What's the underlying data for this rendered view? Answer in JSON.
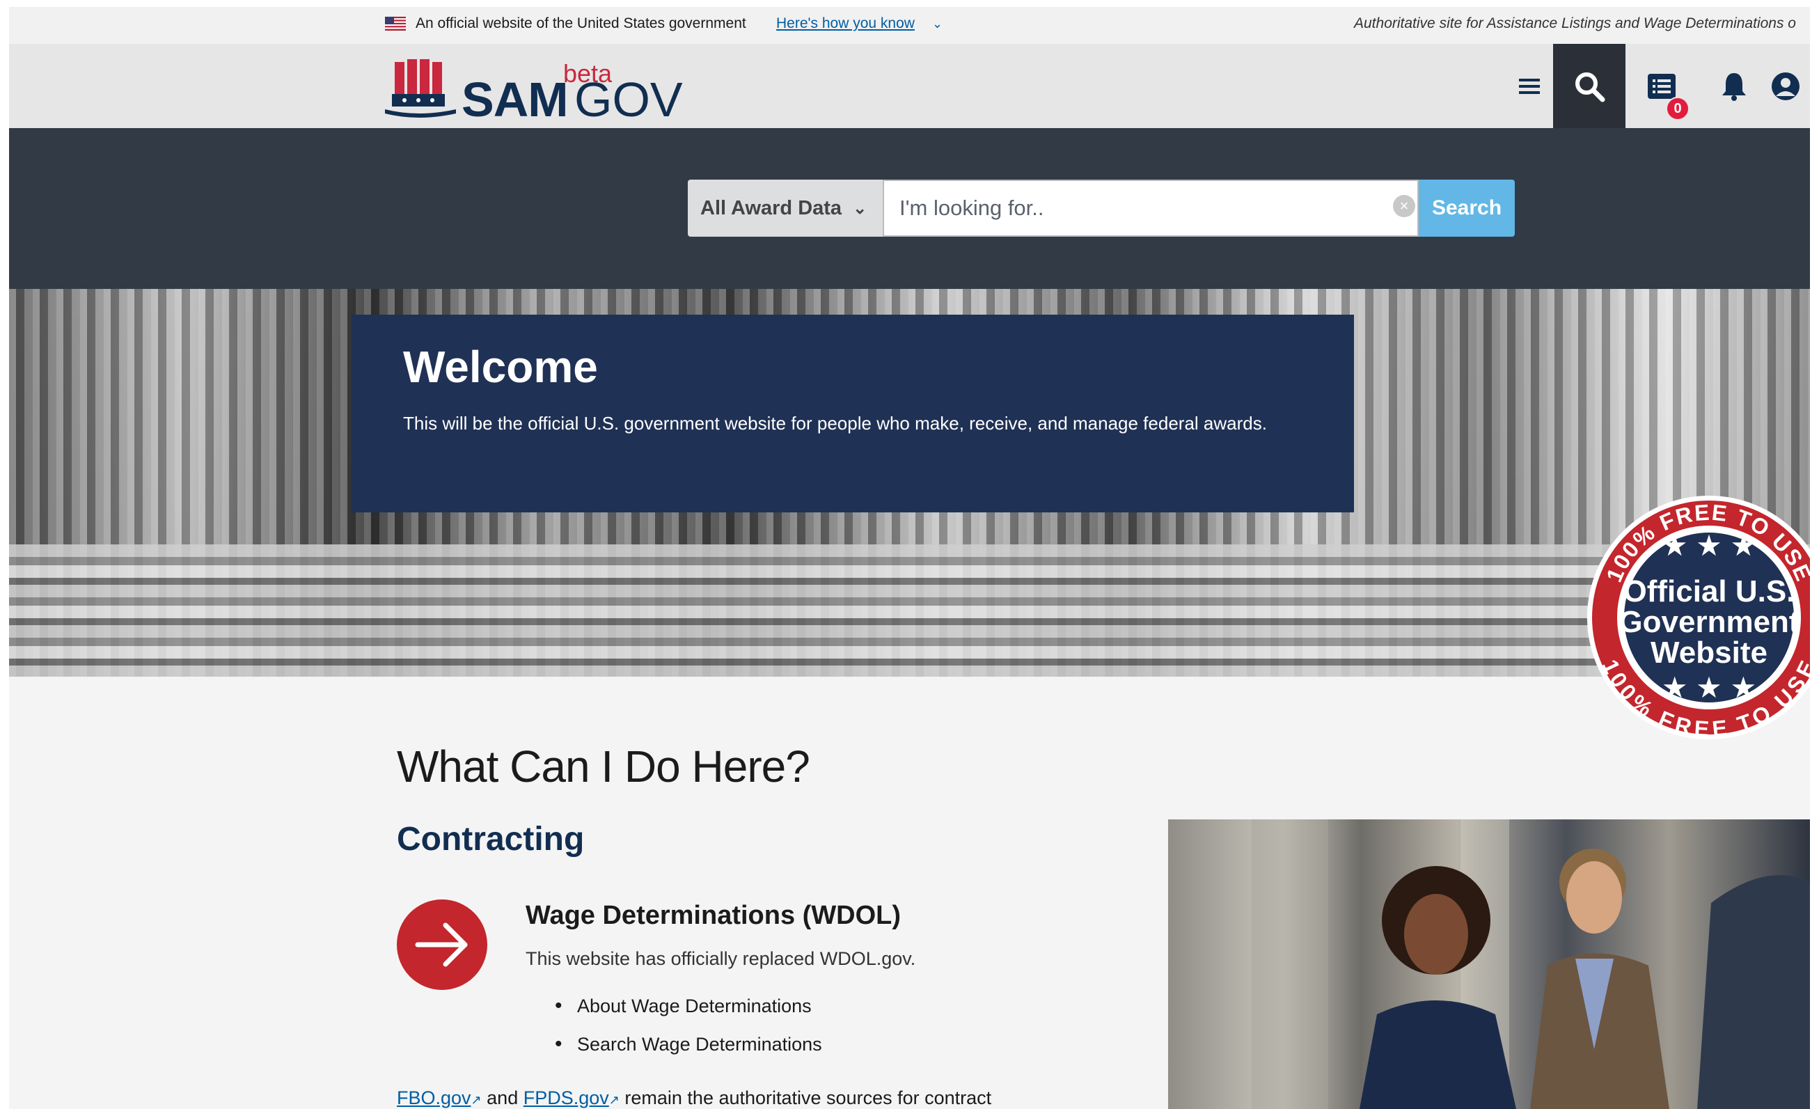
{
  "gov_banner": {
    "text": "An official website of the United States government",
    "link": "Here's how you know",
    "right_text": "Authoritative site for Assistance Listings and Wage Determinations o"
  },
  "header": {
    "logo_main": "SAM",
    "logo_beta": "beta",
    "logo_gov": "GOV",
    "notification_count": "0"
  },
  "search": {
    "select_label": "All Award Data",
    "placeholder": "I'm looking for..",
    "button_label": "Search"
  },
  "hero": {
    "title": "Welcome",
    "text": "This will be the official U.S. government website for people who make, receive, and manage federal awards."
  },
  "seal": {
    "top_text": "100% FREE TO USE",
    "bottom_text": "100% FREE TO USE",
    "line1": "Official U.S.",
    "line2": "Government",
    "line3": "Website"
  },
  "main": {
    "title": "What Can I Do Here?",
    "section_title": "Contracting",
    "wdol": {
      "title": "Wage Determinations (WDOL)",
      "description": "This website has officially replaced WDOL.gov.",
      "links": [
        "About Wage Determinations",
        "Search Wage Determinations"
      ]
    },
    "footnote": {
      "link1": "FBO.gov",
      "connector": "and",
      "link2": "FPDS.gov",
      "text": "remain the authoritative sources for contract"
    }
  },
  "colors": {
    "navy": "#112e51",
    "search_band": "#323a45",
    "search_button": "#63b7e6",
    "accent_red": "#c3262c",
    "welcome_box": "#1f3154"
  }
}
